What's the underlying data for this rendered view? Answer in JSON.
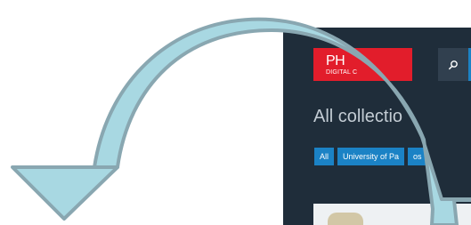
{
  "header": {
    "logo_main": "PH",
    "logo_sub": "DIGITAL C"
  },
  "page": {
    "title": "All collectio"
  },
  "filters": {
    "items": [
      {
        "label": "All"
      },
      {
        "label": "University of Pa"
      },
      {
        "label": "os"
      }
    ]
  },
  "icons": {
    "search": "search-icon",
    "arrow": "curved-arrow-icon"
  },
  "colors": {
    "app_background": "#1f2d3a",
    "brand_red": "#e21d2b",
    "filter_blue": "#1b82c5",
    "arrow_fill": "#a8d8e2",
    "arrow_stroke": "#89a7b1"
  }
}
